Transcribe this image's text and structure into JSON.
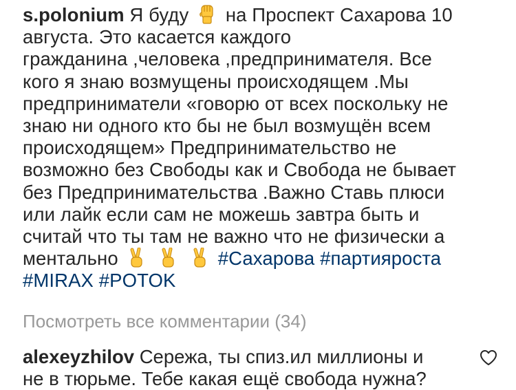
{
  "post": {
    "author": "s.polonium",
    "caption_lines": [
      "Я буду",
      "на Проспект Сахарова 10",
      "августа. Это касается каждого",
      "гражданина ,человека ,предпринимателя. Все",
      "кого я знаю возмущены происходящем .Мы",
      "предприниматели «говорю от всех поскольку не",
      "знаю ни одного кто бы не был возмущён всем",
      "происходящем» Предпринимательство не",
      "возможно без Свободы как и Свобода не бывает",
      "без Предпринимательства .Важно Ставь плюси",
      "или  лайк если сам не можешь завтра быть  и",
      "считай что ты там не важно что не физически а",
      "ментально"
    ],
    "hashtags": [
      "#Сахарова",
      "#партияроста",
      "#MIRAX",
      "#POTOK"
    ],
    "emoji": {
      "fist": "raised-fist-emoji",
      "victory": "victory-hand-emoji"
    }
  },
  "view_all_comments": "Посмотреть все комментарии (34)",
  "comment": {
    "author": "alexeyzhilov",
    "text_line1": "Сережа, ты спиз.ил миллионы и",
    "text_line2": "не в тюрьме. Тебе какая ещё свобода нужна?"
  },
  "colors": {
    "text": "#262626",
    "hashtag": "#003569",
    "muted": "#999999",
    "emoji_yellow": "#FFC83D",
    "emoji_outline": "#C88A12"
  },
  "icons": {
    "like": "heart-icon"
  }
}
